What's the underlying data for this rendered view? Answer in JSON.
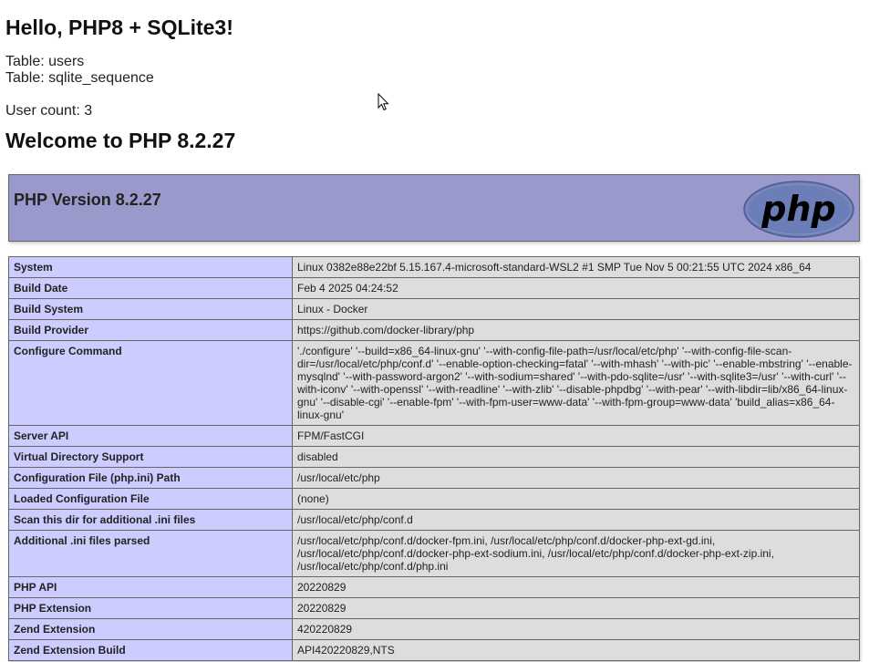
{
  "page": {
    "hello_heading": "Hello, PHP8 + SQLite3!",
    "tables": [
      "Table: users",
      "Table: sqlite_sequence"
    ],
    "user_count": "User count: 3",
    "welcome_heading": "Welcome to PHP 8.2.27"
  },
  "phpinfo": {
    "version_title": "PHP Version 8.2.27",
    "logo_text": "php",
    "rows": [
      {
        "key": "System",
        "value": "Linux 0382e88e22bf 5.15.167.4-microsoft-standard-WSL2 #1 SMP Tue Nov 5 00:21:55 UTC 2024 x86_64"
      },
      {
        "key": "Build Date",
        "value": "Feb 4 2025 04:24:52"
      },
      {
        "key": "Build System",
        "value": "Linux - Docker"
      },
      {
        "key": "Build Provider",
        "value": "https://github.com/docker-library/php"
      },
      {
        "key": "Configure Command",
        "value": "'./configure' '--build=x86_64-linux-gnu' '--with-config-file-path=/usr/local/etc/php' '--with-config-file-scan-dir=/usr/local/etc/php/conf.d' '--enable-option-checking=fatal' '--with-mhash' '--with-pic' '--enable-mbstring' '--enable-mysqlnd' '--with-password-argon2' '--with-sodium=shared' '--with-pdo-sqlite=/usr' '--with-sqlite3=/usr' '--with-curl' '--with-iconv' '--with-openssl' '--with-readline' '--with-zlib' '--disable-phpdbg' '--with-pear' '--with-libdir=lib/x86_64-linux-gnu' '--disable-cgi' '--enable-fpm' '--with-fpm-user=www-data' '--with-fpm-group=www-data' 'build_alias=x86_64-linux-gnu'"
      },
      {
        "key": "Server API",
        "value": "FPM/FastCGI"
      },
      {
        "key": "Virtual Directory Support",
        "value": "disabled"
      },
      {
        "key": "Configuration File (php.ini) Path",
        "value": "/usr/local/etc/php"
      },
      {
        "key": "Loaded Configuration File",
        "value": "(none)"
      },
      {
        "key": "Scan this dir for additional .ini files",
        "value": "/usr/local/etc/php/conf.d"
      },
      {
        "key": "Additional .ini files parsed",
        "value": "/usr/local/etc/php/conf.d/docker-fpm.ini, /usr/local/etc/php/conf.d/docker-php-ext-gd.ini, /usr/local/etc/php/conf.d/docker-php-ext-sodium.ini, /usr/local/etc/php/conf.d/docker-php-ext-zip.ini, /usr/local/etc/php/conf.d/php.ini"
      },
      {
        "key": "PHP API",
        "value": "20220829"
      },
      {
        "key": "PHP Extension",
        "value": "20220829"
      },
      {
        "key": "Zend Extension",
        "value": "420220829"
      },
      {
        "key": "Zend Extension Build",
        "value": "API420220829,NTS"
      }
    ]
  },
  "colors": {
    "header_bg": "#9999cc",
    "key_cell_bg": "#ccccff",
    "value_cell_bg": "#dddddd",
    "logo_bg": "#6c7eb7"
  },
  "icons": {
    "cursor": "mouse-pointer-icon"
  }
}
